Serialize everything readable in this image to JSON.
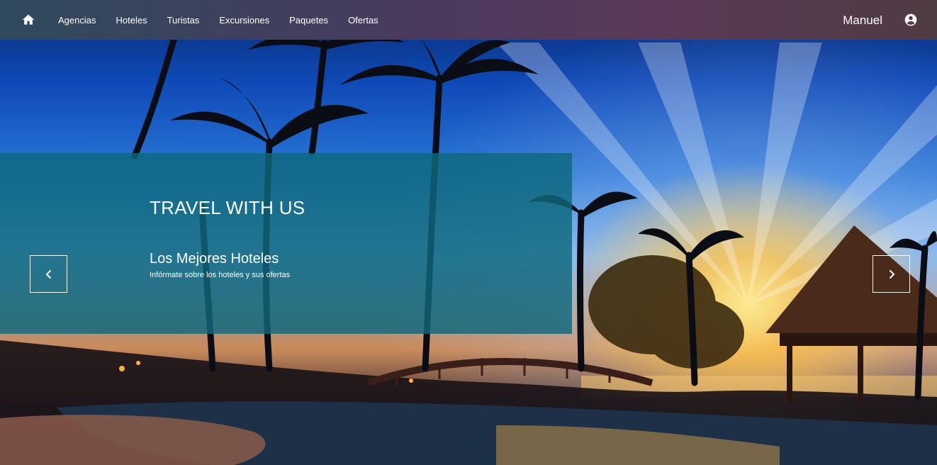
{
  "nav": {
    "home_icon": "home-icon",
    "links": [
      {
        "label": "Agencias"
      },
      {
        "label": "Hoteles"
      },
      {
        "label": "Turistas"
      },
      {
        "label": "Excursiones"
      },
      {
        "label": "Paquetes"
      },
      {
        "label": "Ofertas"
      }
    ],
    "user": {
      "name": "Manuel",
      "icon": "account-circle-icon"
    }
  },
  "hero": {
    "heading": "TRAVEL WITH US",
    "slide": {
      "title": "Los Mejores Hoteles",
      "subtitle": "Infórmate sobre los hoteles y sus ofertas"
    },
    "prev_icon": "chevron-left-icon",
    "next_icon": "chevron-right-icon"
  },
  "colors": {
    "panel": "#0e687c",
    "text": "#ffffff"
  }
}
